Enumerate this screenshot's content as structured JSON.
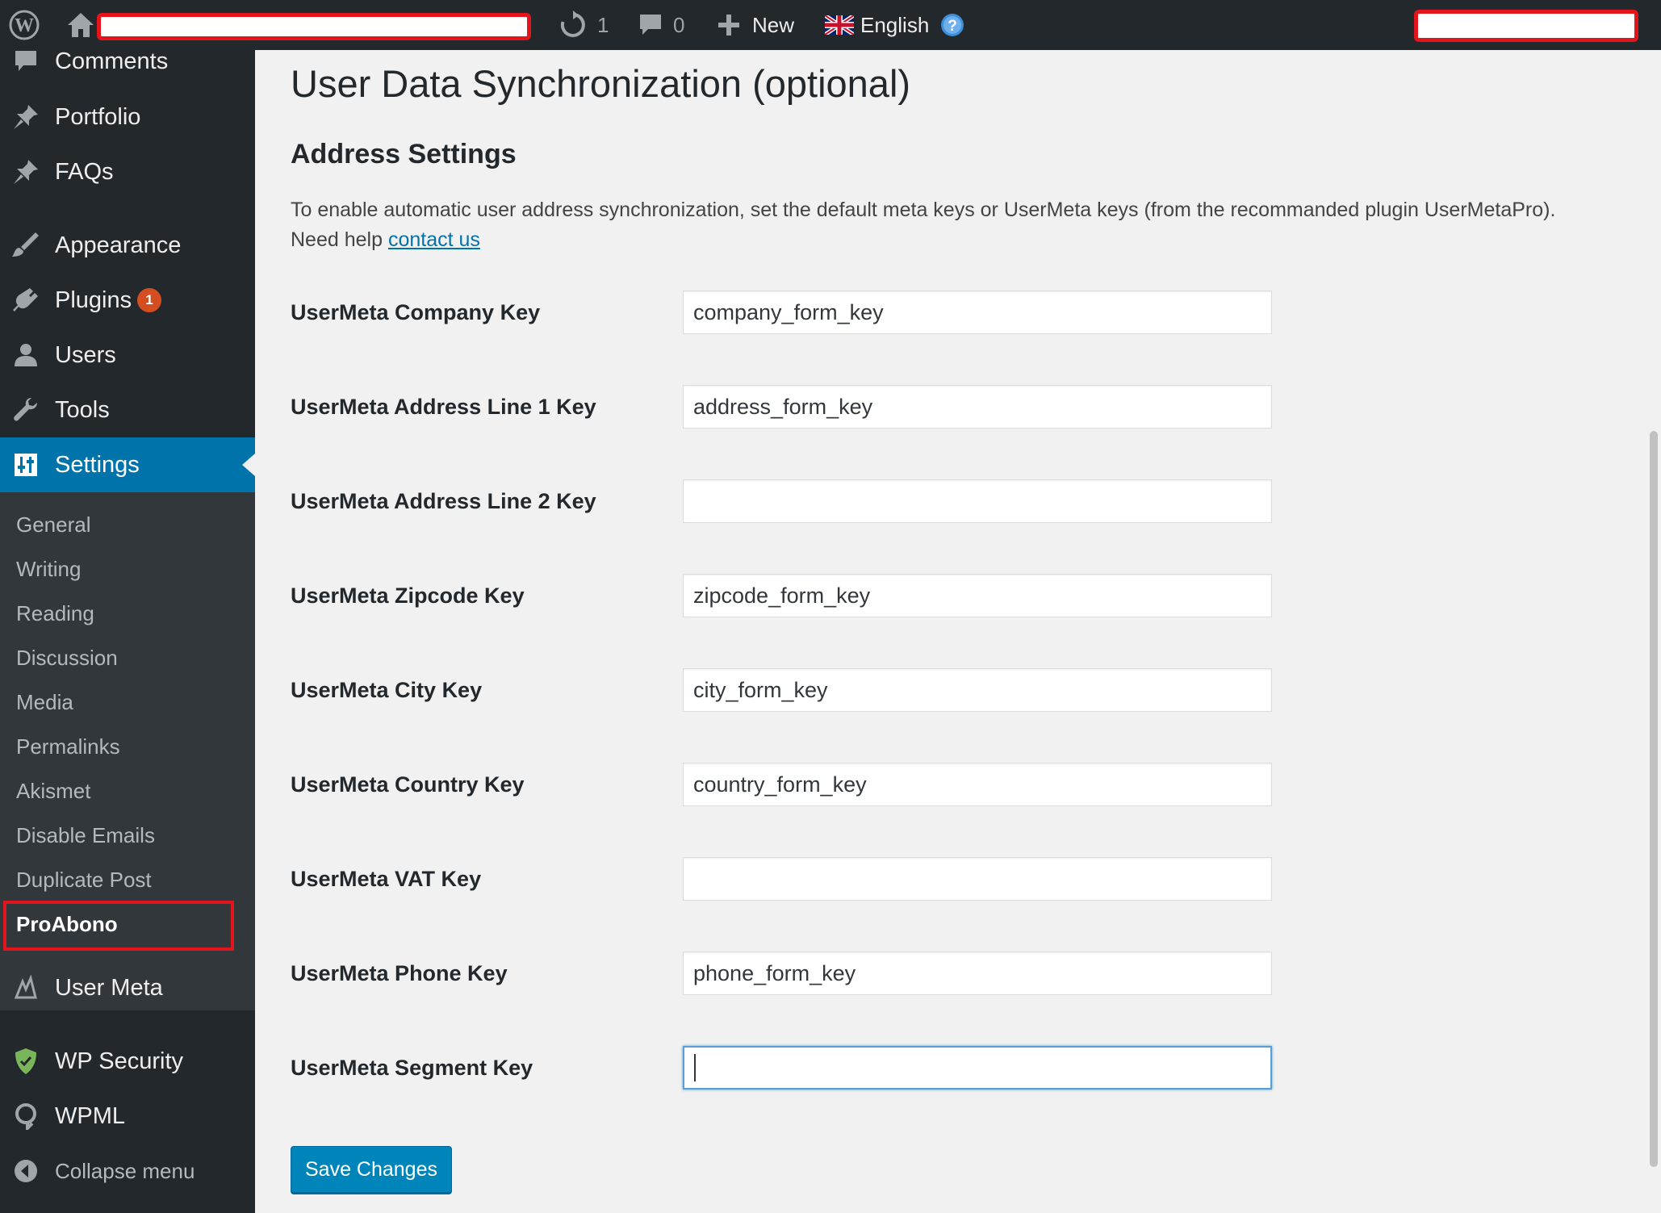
{
  "adminbar": {
    "updates_count": "1",
    "comments_count": "0",
    "new_label": "New",
    "language_label": "English",
    "icons": [
      "wordpress-logo-icon",
      "home-icon",
      "refresh-icon",
      "comment-bubble-icon",
      "plus-icon",
      "uk-flag-icon",
      "help-icon"
    ]
  },
  "sidebar": {
    "items": [
      {
        "label": "Comments",
        "icon": "comment-icon"
      },
      {
        "label": "Portfolio",
        "icon": "pin-icon"
      },
      {
        "label": "FAQs",
        "icon": "pin-icon"
      },
      {
        "label": "Appearance",
        "icon": "brush-icon"
      },
      {
        "label": "Plugins",
        "icon": "plug-icon",
        "badge": "1"
      },
      {
        "label": "Users",
        "icon": "user-icon"
      },
      {
        "label": "Tools",
        "icon": "wrench-icon"
      },
      {
        "label": "Settings",
        "icon": "sliders-icon",
        "active": true
      }
    ],
    "submenu": [
      "General",
      "Writing",
      "Reading",
      "Discussion",
      "Media",
      "Permalinks",
      "Akismet",
      "Disable Emails",
      "Duplicate Post",
      "ProAbono"
    ],
    "submenu_current": "ProAbono",
    "lower_items": [
      {
        "label": "User Meta",
        "icon": "usermeta-icon"
      },
      {
        "label": "WP Security",
        "icon": "shield-icon"
      },
      {
        "label": "WPML",
        "icon": "wpml-icon"
      },
      {
        "label": "Collapse menu",
        "icon": "collapse-icon"
      }
    ]
  },
  "main": {
    "page_title": "User Data Synchronization (optional)",
    "section_title": "Address Settings",
    "intro_text": "To enable automatic user address synchronization, set the default meta keys or UserMeta keys (from the recommanded plugin UserMetaPro).",
    "help_prefix": "Need help",
    "help_link": "contact us",
    "fields": [
      {
        "label": "UserMeta Company Key",
        "value": "company_form_key"
      },
      {
        "label": "UserMeta Address Line 1 Key",
        "value": "address_form_key"
      },
      {
        "label": "UserMeta Address Line 2 Key",
        "value": ""
      },
      {
        "label": "UserMeta Zipcode Key",
        "value": "zipcode_form_key"
      },
      {
        "label": "UserMeta City Key",
        "value": "city_form_key"
      },
      {
        "label": "UserMeta Country Key",
        "value": "country_form_key"
      },
      {
        "label": "UserMeta VAT Key",
        "value": ""
      },
      {
        "label": "UserMeta Phone Key",
        "value": "phone_form_key"
      },
      {
        "label": "UserMeta Segment Key",
        "value": ""
      }
    ],
    "save_label": "Save Changes"
  },
  "colors": {
    "accent": "#0073aa",
    "sidebar_bg": "#23282d",
    "submenu_bg": "#32373c",
    "badge": "#d54e21",
    "redaction_border": "#e3141c"
  }
}
